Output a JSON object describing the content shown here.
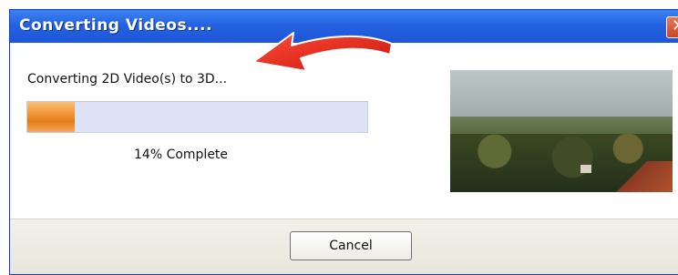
{
  "window": {
    "title": "Converting Videos....",
    "close_glyph": "✕"
  },
  "status": {
    "message": "Converting 2D Video(s) to 3D...",
    "progress_percent": 14,
    "progress_label": "14% Complete"
  },
  "preview": {
    "icon": "video-frame-preview"
  },
  "buttons": {
    "cancel_label": "Cancel"
  },
  "colors": {
    "titlebar": "#2462e0",
    "progress_fill": "#f09a3a",
    "progress_track": "#dde2f4",
    "annotation_arrow": "#e02a1c"
  }
}
